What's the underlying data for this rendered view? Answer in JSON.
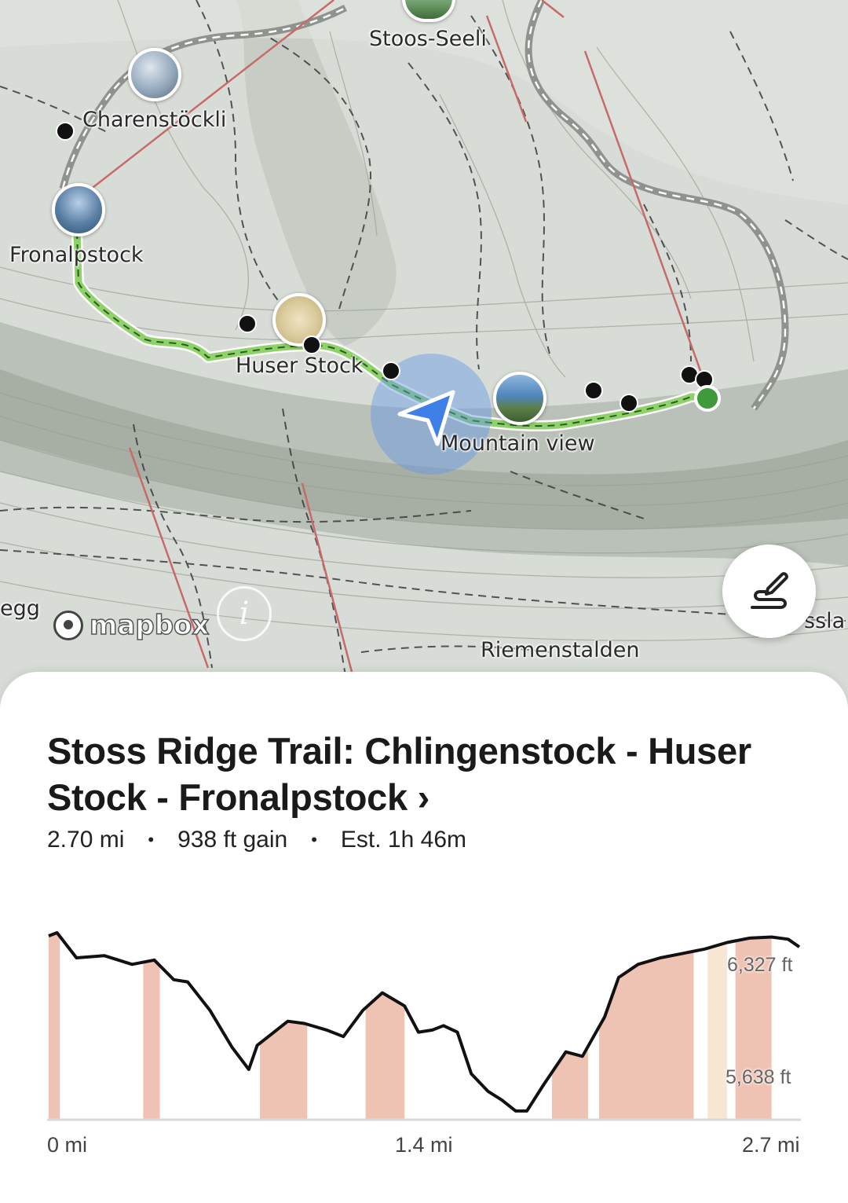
{
  "map": {
    "labels": {
      "stoos_seeli": "Stoos-Seeli",
      "charenstockli": "Charenstöckli",
      "fronalpstock": "Fronalpstock",
      "huser_stock": "Huser Stock",
      "mountain_view": "Mountain view",
      "riemenstalden": "Riemenstalden",
      "left_edge": "egg",
      "right_edge": "ssla"
    },
    "attribution": "mapbox",
    "info_icon": "i",
    "route_color": "#8fd16a",
    "start_marker_color": "#3f9a3a",
    "location_color": "#3f7fe8",
    "draw_button_icon": "draw-route-icon"
  },
  "trail": {
    "title": "Stoss Ridge Trail: Chlingenstock - Huser Stock - Fronalpstock ›",
    "distance": "2.70 mi",
    "gain": "938 ft gain",
    "estimate": "Est. 1h 46m",
    "separator": "•"
  },
  "chart_data": {
    "type": "area",
    "x_unit": "mi",
    "y_unit": "ft",
    "xlim": [
      0,
      2.7
    ],
    "x_ticks": [
      "0 mi",
      "1.4 mi",
      "2.7 mi"
    ],
    "y_labels": [
      "6,327 ft",
      "5,638 ft"
    ],
    "series": [
      {
        "x": [
          0,
          0.03,
          0.1,
          0.2,
          0.3,
          0.38,
          0.45,
          0.5,
          0.58,
          0.66,
          0.72,
          0.75,
          0.8,
          0.86,
          0.92,
          1.0,
          1.06,
          1.13,
          1.2,
          1.28,
          1.33,
          1.38,
          1.42,
          1.47,
          1.52,
          1.58,
          1.63,
          1.68,
          1.72,
          1.78,
          1.86,
          1.92,
          2.0,
          2.05,
          2.12,
          2.2,
          2.28,
          2.36,
          2.44,
          2.52,
          2.6,
          2.66,
          2.7
        ],
        "y": [
          6400,
          6415,
          6300,
          6310,
          6270,
          6290,
          6200,
          6190,
          6060,
          5890,
          5790,
          5900,
          5950,
          6010,
          6000,
          5970,
          5940,
          6060,
          6140,
          6080,
          5960,
          5970,
          5990,
          5960,
          5770,
          5690,
          5650,
          5600,
          5600,
          5720,
          5870,
          5850,
          6030,
          6210,
          6270,
          6300,
          6320,
          6340,
          6370,
          6390,
          6395,
          6385,
          6350
        ]
      }
    ],
    "grade_bands": [
      {
        "from": 0.0,
        "to": 0.04,
        "color": "#efc3b3"
      },
      {
        "from": 0.34,
        "to": 0.4,
        "color": "#efc3b3"
      },
      {
        "from": 0.76,
        "to": 0.93,
        "color": "#efc3b3"
      },
      {
        "from": 1.14,
        "to": 1.28,
        "color": "#efc3b3"
      },
      {
        "from": 1.81,
        "to": 1.94,
        "color": "#efc3b3"
      },
      {
        "from": 1.98,
        "to": 2.32,
        "color": "#efc3b3"
      },
      {
        "from": 2.37,
        "to": 2.44,
        "color": "#f7e7d2"
      },
      {
        "from": 2.47,
        "to": 2.6,
        "color": "#efc3b3"
      }
    ]
  }
}
